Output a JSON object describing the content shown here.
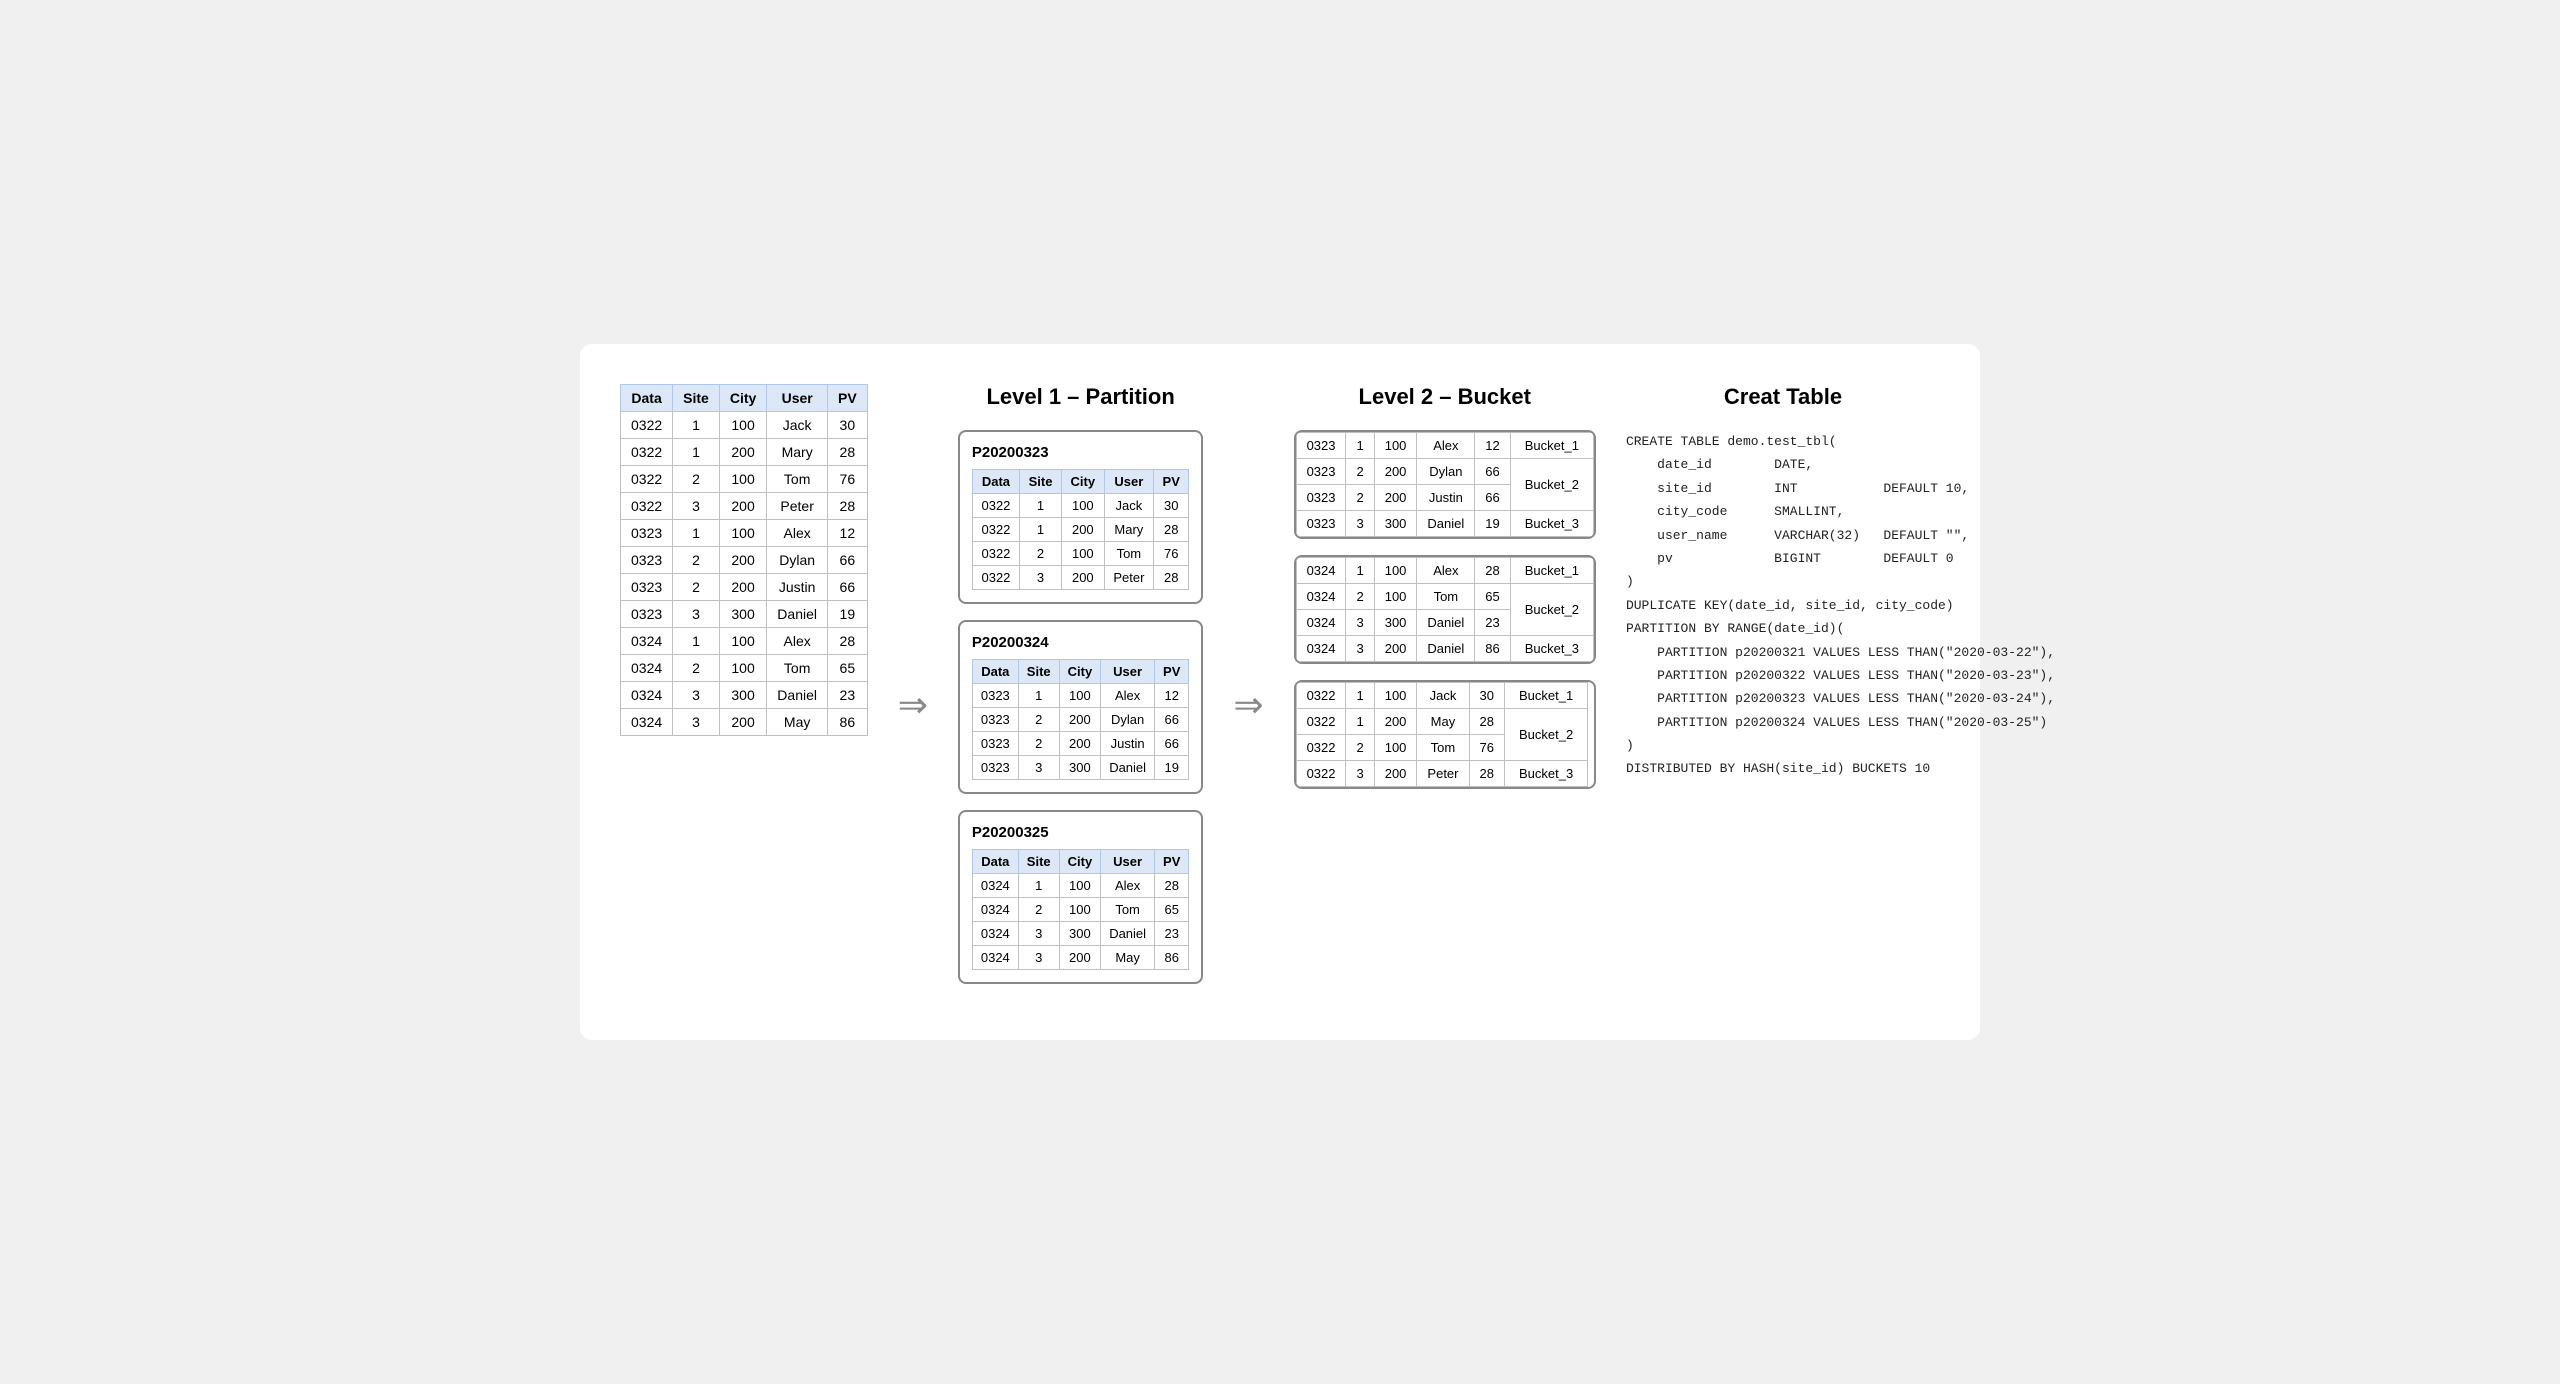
{
  "raw_table": {
    "headers": [
      "Data",
      "Site",
      "City",
      "User",
      "PV"
    ],
    "rows": [
      [
        "0322",
        "1",
        "100",
        "Jack",
        "30"
      ],
      [
        "0322",
        "1",
        "200",
        "Mary",
        "28"
      ],
      [
        "0322",
        "2",
        "100",
        "Tom",
        "76"
      ],
      [
        "0322",
        "3",
        "200",
        "Peter",
        "28"
      ],
      [
        "0323",
        "1",
        "100",
        "Alex",
        "12"
      ],
      [
        "0323",
        "2",
        "200",
        "Dylan",
        "66"
      ],
      [
        "0323",
        "2",
        "200",
        "Justin",
        "66"
      ],
      [
        "0323",
        "3",
        "300",
        "Daniel",
        "19"
      ],
      [
        "0324",
        "1",
        "100",
        "Alex",
        "28"
      ],
      [
        "0324",
        "2",
        "100",
        "Tom",
        "65"
      ],
      [
        "0324",
        "3",
        "300",
        "Daniel",
        "23"
      ],
      [
        "0324",
        "3",
        "200",
        "May",
        "86"
      ]
    ]
  },
  "partition_section": {
    "title": "Level 1 – Partition",
    "partitions": [
      {
        "label": "P20200323",
        "headers": [
          "Data",
          "Site",
          "City",
          "User",
          "PV"
        ],
        "rows": [
          [
            "0322",
            "1",
            "100",
            "Jack",
            "30"
          ],
          [
            "0322",
            "1",
            "200",
            "Mary",
            "28"
          ],
          [
            "0322",
            "2",
            "100",
            "Tom",
            "76"
          ],
          [
            "0322",
            "3",
            "200",
            "Peter",
            "28"
          ]
        ]
      },
      {
        "label": "P20200324",
        "headers": [
          "Data",
          "Site",
          "City",
          "User",
          "PV"
        ],
        "rows": [
          [
            "0323",
            "1",
            "100",
            "Alex",
            "12"
          ],
          [
            "0323",
            "2",
            "200",
            "Dylan",
            "66"
          ],
          [
            "0323",
            "2",
            "200",
            "Justin",
            "66"
          ],
          [
            "0323",
            "3",
            "300",
            "Daniel",
            "19"
          ]
        ]
      },
      {
        "label": "P20200325",
        "headers": [
          "Data",
          "Site",
          "City",
          "User",
          "PV"
        ],
        "rows": [
          [
            "0324",
            "1",
            "100",
            "Alex",
            "28"
          ],
          [
            "0324",
            "2",
            "100",
            "Tom",
            "65"
          ],
          [
            "0324",
            "3",
            "300",
            "Daniel",
            "23"
          ],
          [
            "0324",
            "3",
            "200",
            "May",
            "86"
          ]
        ]
      }
    ]
  },
  "bucket_section": {
    "title": "Level 2 – Bucket",
    "groups": [
      {
        "rows": [
          {
            "data": [
              "0323",
              "1",
              "100",
              "Alex",
              "12"
            ],
            "bucket": "Bucket_1",
            "bucket_span": 1
          },
          {
            "data": [
              "0323",
              "2",
              "200",
              "Dylan",
              "66"
            ],
            "bucket": "Bucket_2",
            "bucket_span": 2
          },
          {
            "data": [
              "0323",
              "2",
              "200",
              "Justin",
              "66"
            ],
            "bucket": null,
            "bucket_span": 0
          },
          {
            "data": [
              "0323",
              "3",
              "300",
              "Daniel",
              "19"
            ],
            "bucket": "Bucket_3",
            "bucket_span": 1
          }
        ]
      },
      {
        "rows": [
          {
            "data": [
              "0324",
              "1",
              "100",
              "Alex",
              "28"
            ],
            "bucket": "Bucket_1",
            "bucket_span": 1
          },
          {
            "data": [
              "0324",
              "2",
              "100",
              "Tom",
              "65"
            ],
            "bucket": "Bucket_2",
            "bucket_span": 2
          },
          {
            "data": [
              "0324",
              "3",
              "300",
              "Daniel",
              "23"
            ],
            "bucket": null,
            "bucket_span": 0
          },
          {
            "data": [
              "0324",
              "3",
              "200",
              "Daniel",
              "86"
            ],
            "bucket": "Bucket_3",
            "bucket_span": 1
          }
        ]
      },
      {
        "rows": [
          {
            "data": [
              "0322",
              "1",
              "100",
              "Jack",
              "30"
            ],
            "bucket": "Bucket_1",
            "bucket_span": 1
          },
          {
            "data": [
              "0322",
              "1",
              "200",
              "May",
              "28"
            ],
            "bucket": "Bucket_2",
            "bucket_span": 2
          },
          {
            "data": [
              "0322",
              "2",
              "100",
              "Tom",
              "76"
            ],
            "bucket": null,
            "bucket_span": 0
          },
          {
            "data": [
              "0322",
              "3",
              "200",
              "Peter",
              "28"
            ],
            "bucket": "Bucket_3",
            "bucket_span": 1
          }
        ]
      }
    ]
  },
  "code_section": {
    "title": "Creat Table",
    "lines": [
      "CREATE TABLE demo.test_tbl(",
      "    date_id        DATE,",
      "    site_id        INT           DEFAULT 10,",
      "    city_code      SMALLINT,",
      "    user_name      VARCHAR(32)   DEFAULT \"\",",
      "    pv             BIGINT        DEFAULT 0",
      ")",
      "",
      "DUPLICATE KEY(date_id, site_id, city_code)",
      "",
      "PARTITION BY RANGE(date_id)(",
      "    PARTITION p20200321 VALUES LESS THAN(\"2020-03-22\"),",
      "    PARTITION p20200322 VALUES LESS THAN(\"2020-03-23\"),",
      "    PARTITION p20200323 VALUES LESS THAN(\"2020-03-24\"),",
      "    PARTITION p20200324 VALUES LESS THAN(\"2020-03-25\")",
      ")",
      "",
      "DISTRIBUTED BY HASH(site_id) BUCKETS 10"
    ]
  },
  "arrows": {
    "arrow1": "⇒",
    "arrow2": "⇒"
  }
}
